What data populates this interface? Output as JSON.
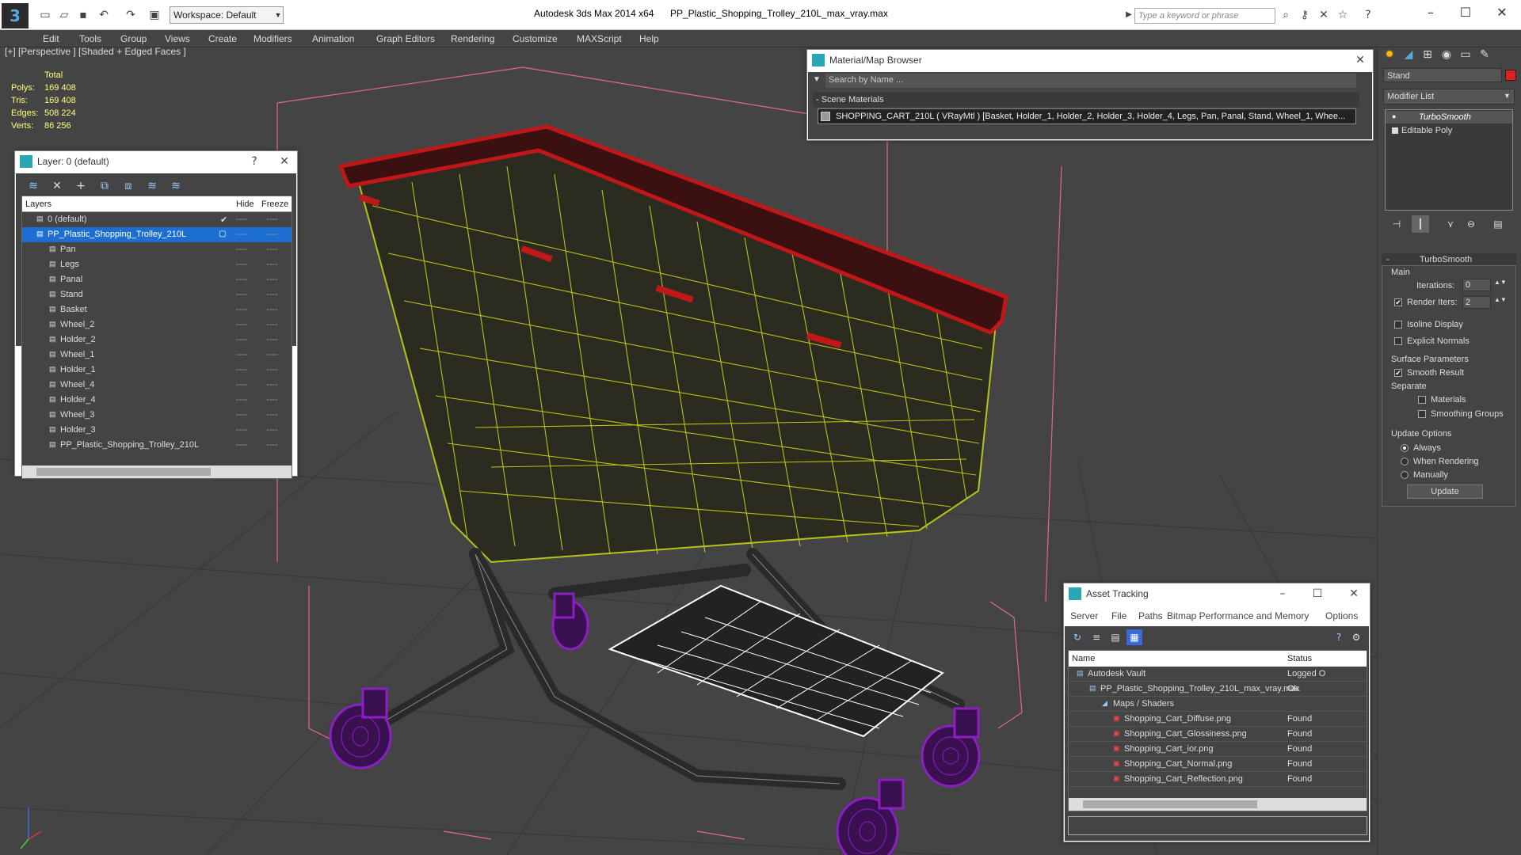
{
  "app": {
    "workspace": "Workspace: Default",
    "product": "Autodesk 3ds Max  2014 x64",
    "filename": "PP_Plastic_Shopping_Trolley_210L_max_vray.max",
    "keyword_placeholder": "Type a keyword or phrase"
  },
  "menu": [
    "Edit",
    "Tools",
    "Group",
    "Views",
    "Create",
    "Modifiers",
    "Animation",
    "Graph Editors",
    "Rendering",
    "Customize",
    "MAXScript",
    "Help"
  ],
  "viewport": {
    "label": "[+] [Perspective ] [Shaded + Edged Faces ]",
    "stats": {
      "header": "Total",
      "rows": [
        {
          "label": "Polys:",
          "value": "169 408"
        },
        {
          "label": "Tris:",
          "value": "169 408"
        },
        {
          "label": "Edges:",
          "value": "508 224"
        },
        {
          "label": "Verts:",
          "value": "86 256"
        }
      ]
    }
  },
  "layer_panel": {
    "title": "Layer: 0 (default)",
    "help": "?",
    "columns": {
      "layers": "Layers",
      "hide": "Hide",
      "freeze": "Freeze"
    },
    "rows": [
      {
        "name": "0 (default)",
        "check": "✔"
      },
      {
        "name": "PP_Plastic_Shopping_Trolley_210L"
      },
      {
        "name": "Pan"
      },
      {
        "name": "Legs"
      },
      {
        "name": "Panal"
      },
      {
        "name": "Stand"
      },
      {
        "name": "Basket"
      },
      {
        "name": "Wheel_2"
      },
      {
        "name": "Holder_2"
      },
      {
        "name": "Wheel_1"
      },
      {
        "name": "Holder_1"
      },
      {
        "name": "Wheel_4"
      },
      {
        "name": "Holder_4"
      },
      {
        "name": "Wheel_3"
      },
      {
        "name": "Holder_3"
      },
      {
        "name": "PP_Plastic_Shopping_Trolley_210L"
      }
    ],
    "dash": "----"
  },
  "material_browser": {
    "title": "Material/Map Browser",
    "search_placeholder": "Search by Name ...",
    "section": "- Scene Materials",
    "item": "SHOPPING_CART_210L  ( VRayMtl )  [Basket, Holder_1, Holder_2, Holder_3, Holder_4, Legs, Pan, Panal, Stand, Wheel_1, Whee..."
  },
  "command_panel": {
    "object_name": "Stand",
    "object_color": "#e02020",
    "modifier_list": "Modifier List",
    "stack": [
      "TurboSmooth",
      "Editable Poly"
    ],
    "rollout_title": "TurboSmooth",
    "main": "Main",
    "iterations_label": "Iterations:",
    "iterations_value": "0",
    "render_iters_label": "Render Iters:",
    "render_iters_value": "2",
    "isoline": "Isoline Display",
    "explicit_normals": "Explicit Normals",
    "surface_params": "Surface Parameters",
    "smooth_result": "Smooth Result",
    "separate": "Separate",
    "materials": "Materials",
    "smoothing_groups": "Smoothing Groups",
    "update_options": "Update Options",
    "always": "Always",
    "when_rendering": "When Rendering",
    "manually": "Manually",
    "update_button": "Update"
  },
  "asset_tracking": {
    "title": "Asset Tracking",
    "menu": [
      "Server",
      "File",
      "Paths",
      "Bitmap Performance and Memory",
      "Options"
    ],
    "columns": {
      "name": "Name",
      "status": "Status"
    },
    "rows": [
      {
        "name": "Autodesk Vault",
        "status": "Logged O"
      },
      {
        "name": "PP_Plastic_Shopping_Trolley_210L_max_vray.max",
        "status": "Ok"
      },
      {
        "name": "Maps / Shaders",
        "status": ""
      },
      {
        "name": "Shopping_Cart_Diffuse.png",
        "status": "Found"
      },
      {
        "name": "Shopping_Cart_Glossiness.png",
        "status": "Found"
      },
      {
        "name": "Shopping_Cart_ior.png",
        "status": "Found"
      },
      {
        "name": "Shopping_Cart_Normal.png",
        "status": "Found"
      },
      {
        "name": "Shopping_Cart_Reflection.png",
        "status": "Found"
      }
    ]
  },
  "colors": {
    "basket_wire": "#b8c21a",
    "handle": "#c01818",
    "wheels": "#8b1fc4",
    "frame": "#2a2a2a",
    "tray": "#ffffff"
  }
}
